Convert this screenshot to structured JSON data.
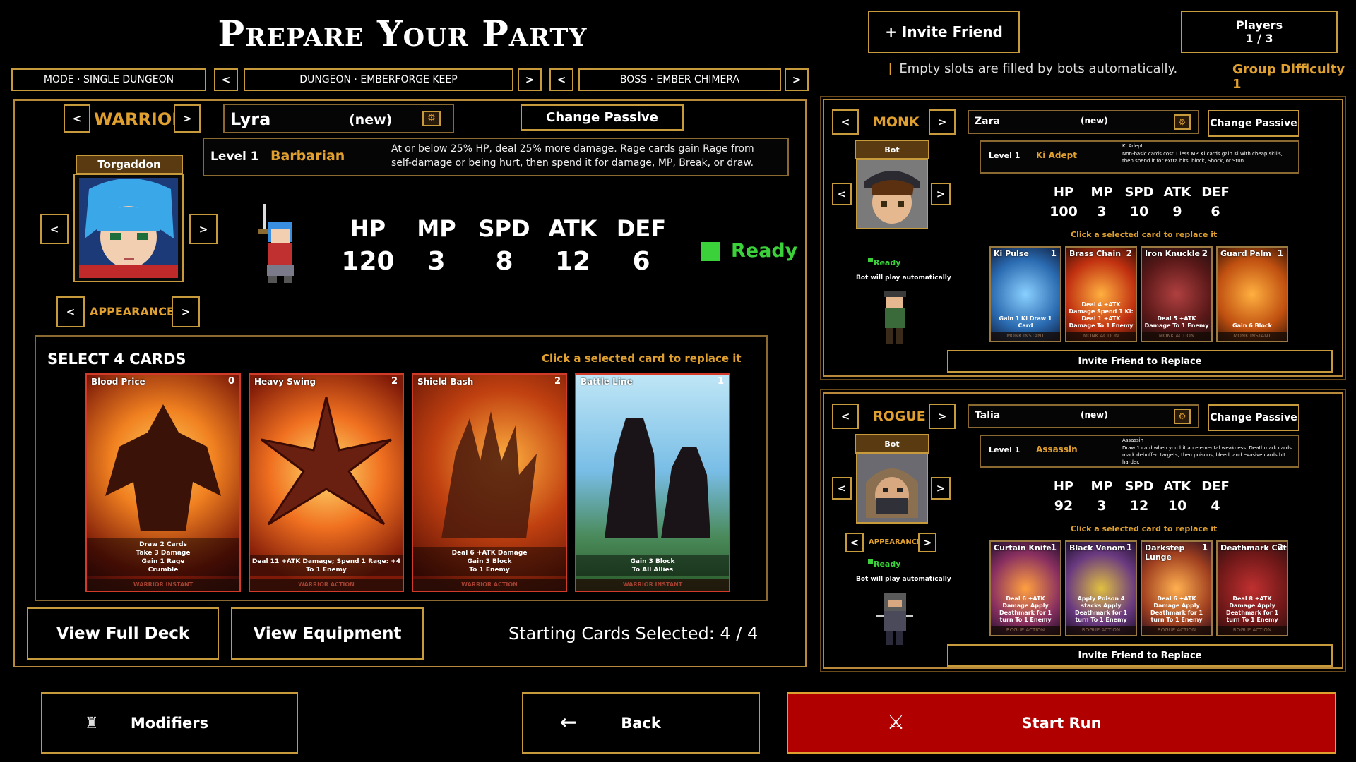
{
  "title": "Prepare Your Party",
  "mode": "MODE · SINGLE DUNGEON",
  "dungeon": "DUNGEON · EMBERFORGE KEEP",
  "boss": "BOSS · EMBER CHIMERA",
  "invite_friend": "+ Invite Friend",
  "players_label": "Players",
  "players_count": "1 / 3",
  "empty_slots_note": "Empty slots are filled by bots automatically.",
  "group_difficulty": "Group Difficulty 1",
  "warrior": {
    "class": "WARRIOR",
    "name": "Lyra",
    "name_tag": "(new)",
    "change_passive": "Change Passive",
    "level": "Level 1",
    "passive": "Barbarian",
    "passive_desc": "At or below 25% HP, deal 25% more damage. Rage cards gain Rage from self-damage or being hurt, then spend it for damage, MP, Break, or draw.",
    "portrait_name": "Torgaddon",
    "appearance": "APPEARANCE",
    "stats": {
      "labels": [
        "HP",
        "MP",
        "SPD",
        "ATK",
        "DEF"
      ],
      "values": [
        "120",
        "3",
        "8",
        "12",
        "6"
      ]
    },
    "ready": "Ready",
    "select_cards": "SELECT 4 CARDS",
    "click_hint": "Click a selected card to replace it",
    "cards": [
      {
        "name": "Blood Price",
        "cost": "0",
        "desc1": "Draw 2 Cards",
        "desc2": "Take 3 Damage",
        "desc3": "Gain 1 Rage",
        "desc4": "Crumble",
        "type": "WARRIOR INSTANT"
      },
      {
        "name": "Heavy Swing",
        "cost": "2",
        "desc1": "Deal 11 +ATK Damage; Spend 1 Rage: +4",
        "desc2": "To 1 Enemy",
        "desc3": "",
        "desc4": "",
        "type": "WARRIOR ACTION"
      },
      {
        "name": "Shield Bash",
        "cost": "2",
        "desc1": "Deal 6 +ATK Damage",
        "desc2": "Gain 3 Block",
        "desc3": "To 1 Enemy",
        "desc4": "",
        "type": "WARRIOR ACTION"
      },
      {
        "name": "Battle Line",
        "cost": "1",
        "desc1": "Gain 3 Block",
        "desc2": "To All Allies",
        "desc3": "",
        "desc4": "",
        "type": "WARRIOR INSTANT"
      }
    ],
    "view_deck": "View Full Deck",
    "view_equipment": "View Equipment",
    "starting_cards": "Starting Cards Selected: 4 / 4"
  },
  "monk": {
    "class": "MONK",
    "name": "Zara",
    "name_tag": "(new)",
    "change_passive": "Change Passive",
    "bot": "Bot",
    "level": "Level 1",
    "passive": "Ki Adept",
    "passive_title": "Ki Adept",
    "passive_desc": "Non-basic cards cost 1 less MP. Ki cards gain Ki with cheap skills, then spend it for extra hits, block, Shock, or Stun.",
    "stats": {
      "labels": [
        "HP",
        "MP",
        "SPD",
        "ATK",
        "DEF"
      ],
      "values": [
        "100",
        "3",
        "10",
        "9",
        "6"
      ]
    },
    "ready": "Ready",
    "bot_note": "Bot will play automatically",
    "click_hint": "Click a selected card to replace it",
    "cards": [
      {
        "name": "Ki Pulse",
        "cost": "1",
        "desc": "Gain 1 Ki Draw 1 Card",
        "type": "MONK INSTANT"
      },
      {
        "name": "Brass Chain",
        "cost": "2",
        "desc": "Deal 4 +ATK Damage Spend 1 Ki: Deal 1 +ATK Damage To 1 Enemy",
        "type": "MONK ACTION"
      },
      {
        "name": "Iron Knuckle",
        "cost": "2",
        "desc": "Deal 5 +ATK Damage To 1 Enemy",
        "type": "MONK ACTION"
      },
      {
        "name": "Guard Palm",
        "cost": "1",
        "desc": "Gain 6 Block",
        "type": "MONK INSTANT"
      }
    ],
    "invite_replace": "Invite Friend to Replace"
  },
  "rogue": {
    "class": "ROGUE",
    "name": "Talia",
    "name_tag": "(new)",
    "change_passive": "Change Passive",
    "bot": "Bot",
    "level": "Level 1",
    "passive": "Assassin",
    "passive_title": "Assassin",
    "passive_desc": "Draw 1 card when you hit an elemental weakness. Deathmark cards mark debuffed targets, then poisons, bleed, and evasive cards hit harder.",
    "stats": {
      "labels": [
        "HP",
        "MP",
        "SPD",
        "ATK",
        "DEF"
      ],
      "values": [
        "92",
        "3",
        "12",
        "10",
        "4"
      ]
    },
    "appearance": "APPEARANCE",
    "ready": "Ready",
    "bot_note": "Bot will play automatically",
    "click_hint": "Click a selected card to replace it",
    "cards": [
      {
        "name": "Curtain Knife",
        "cost": "1",
        "desc": "Deal 6 +ATK Damage Apply Deathmark for 1 turn To 1 Enemy",
        "type": "ROGUE ACTION"
      },
      {
        "name": "Black Venom",
        "cost": "1",
        "desc": "Apply Poison 4 stacks Apply Deathmark for 1 turn To 1 Enemy",
        "type": "ROGUE ACTION"
      },
      {
        "name": "Darkstep Lunge",
        "cost": "1",
        "desc": "Deal 6 +ATK Damage Apply Deathmark for 1 turn To 1 Enemy",
        "type": "ROGUE ACTION"
      },
      {
        "name": "Deathmark Cut",
        "cost": "2",
        "desc": "Deal 8 +ATK Damage Apply Deathmark for 1 turn To 1 Enemy",
        "type": "ROGUE ACTION"
      }
    ],
    "invite_replace": "Invite Friend to Replace"
  },
  "modifiers": "Modifiers",
  "back": "Back",
  "start_run": "Start Run",
  "colors": {
    "gold": "#c79a3c",
    "accent": "#e0a030",
    "ready": "#3ad13a",
    "start": "#b00000"
  }
}
